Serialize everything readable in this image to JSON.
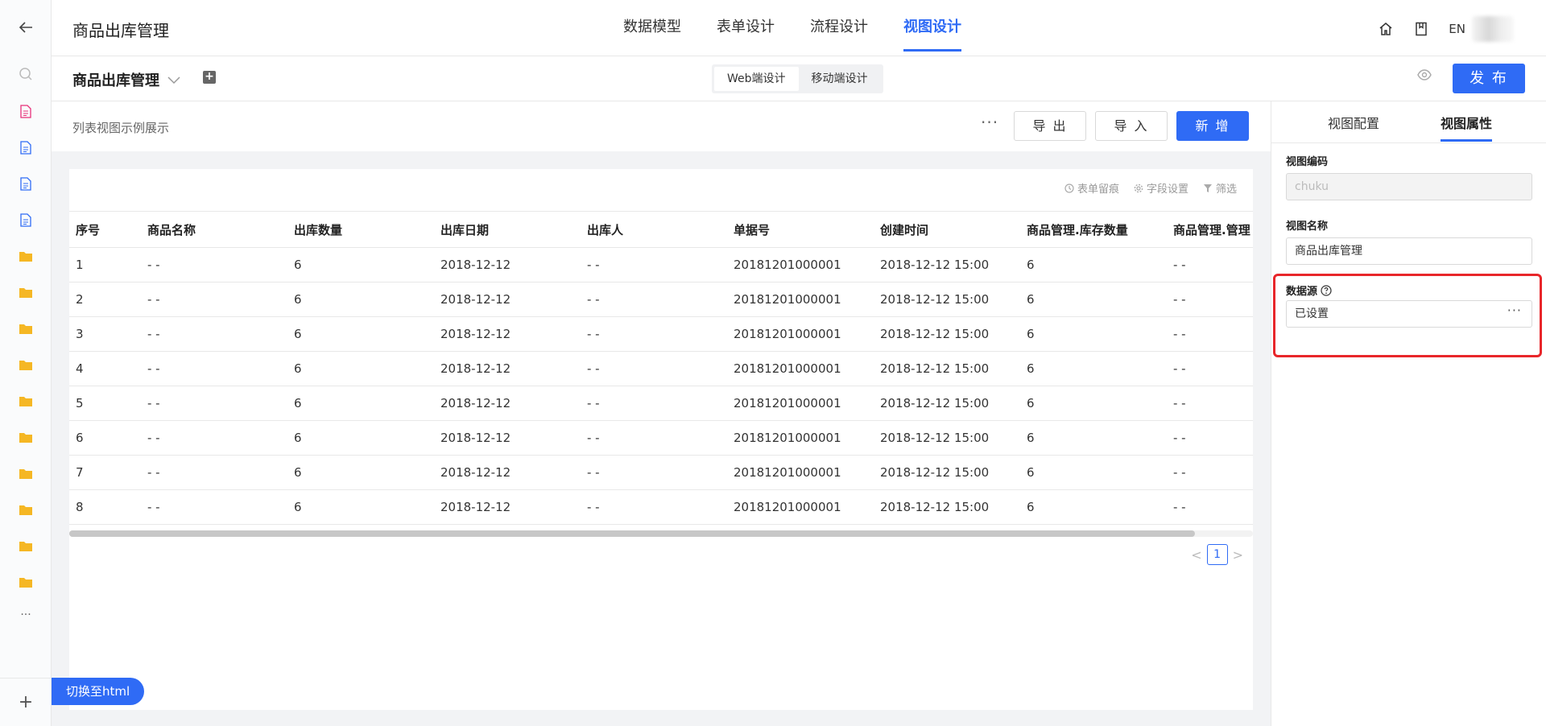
{
  "app": {
    "title": "商品出库管理"
  },
  "nav": {
    "tabs": [
      {
        "label": "数据模型"
      },
      {
        "label": "表单设计"
      },
      {
        "label": "流程设计"
      },
      {
        "label": "视图设计"
      }
    ],
    "active_index": 3,
    "lang": "EN"
  },
  "sidebar": {
    "items": [
      {
        "icon": "doc-pink-icon"
      },
      {
        "icon": "doc-blue-icon"
      },
      {
        "icon": "doc-blue-icon"
      },
      {
        "icon": "doc-blue-icon"
      },
      {
        "icon": "folder-icon"
      },
      {
        "icon": "folder-icon"
      },
      {
        "icon": "folder-icon"
      },
      {
        "icon": "folder-icon"
      },
      {
        "icon": "folder-icon"
      },
      {
        "icon": "folder-icon"
      },
      {
        "icon": "folder-icon"
      },
      {
        "icon": "folder-icon"
      },
      {
        "icon": "folder-icon"
      },
      {
        "icon": "folder-icon"
      }
    ],
    "more": "...",
    "add": "+"
  },
  "subbar": {
    "view_title": "商品出库管理",
    "modes": [
      {
        "label": "Web端设计"
      },
      {
        "label": "移动端设计"
      }
    ],
    "publish_label": "发 布"
  },
  "canvas": {
    "caption": "列表视图示例展示",
    "more": "···",
    "export_label": "导 出",
    "import_label": "导 入",
    "add_label": "新 增",
    "tools": [
      {
        "label": "表单留痕",
        "icon": "clock-icon"
      },
      {
        "label": "字段设置",
        "icon": "gear-icon"
      },
      {
        "label": "筛选",
        "icon": "filter-icon"
      }
    ],
    "switch_html": "切换至html"
  },
  "table": {
    "columns": [
      "序号",
      "商品名称",
      "出库数量",
      "出库日期",
      "出库人",
      "单据号",
      "创建时间",
      "商品管理.库存数量",
      "商品管理.管理"
    ],
    "rows": [
      [
        "1",
        "- -",
        "6",
        "2018-12-12",
        "- -",
        "20181201000001",
        "2018-12-12 15:00",
        "6",
        "- -"
      ],
      [
        "2",
        "- -",
        "6",
        "2018-12-12",
        "- -",
        "20181201000001",
        "2018-12-12 15:00",
        "6",
        "- -"
      ],
      [
        "3",
        "- -",
        "6",
        "2018-12-12",
        "- -",
        "20181201000001",
        "2018-12-12 15:00",
        "6",
        "- -"
      ],
      [
        "4",
        "- -",
        "6",
        "2018-12-12",
        "- -",
        "20181201000001",
        "2018-12-12 15:00",
        "6",
        "- -"
      ],
      [
        "5",
        "- -",
        "6",
        "2018-12-12",
        "- -",
        "20181201000001",
        "2018-12-12 15:00",
        "6",
        "- -"
      ],
      [
        "6",
        "- -",
        "6",
        "2018-12-12",
        "- -",
        "20181201000001",
        "2018-12-12 15:00",
        "6",
        "- -"
      ],
      [
        "7",
        "- -",
        "6",
        "2018-12-12",
        "- -",
        "20181201000001",
        "2018-12-12 15:00",
        "6",
        "- -"
      ],
      [
        "8",
        "- -",
        "6",
        "2018-12-12",
        "- -",
        "20181201000001",
        "2018-12-12 15:00",
        "6",
        "- -"
      ]
    ]
  },
  "pagination": {
    "current": "1",
    "prev": "<",
    "next": ">"
  },
  "props": {
    "tabs": [
      {
        "label": "视图配置"
      },
      {
        "label": "视图属性"
      }
    ],
    "code_label": "视图编码",
    "code_value": "chuku",
    "name_label": "视图名称",
    "name_value": "商品出库管理",
    "source_label": "数据源",
    "source_value": "已设置",
    "source_more": "···"
  },
  "colors": {
    "accent": "#2f6bf5",
    "highlight": "#e8262a",
    "folder": "#f5b724",
    "doc_pink": "#e8317a"
  }
}
